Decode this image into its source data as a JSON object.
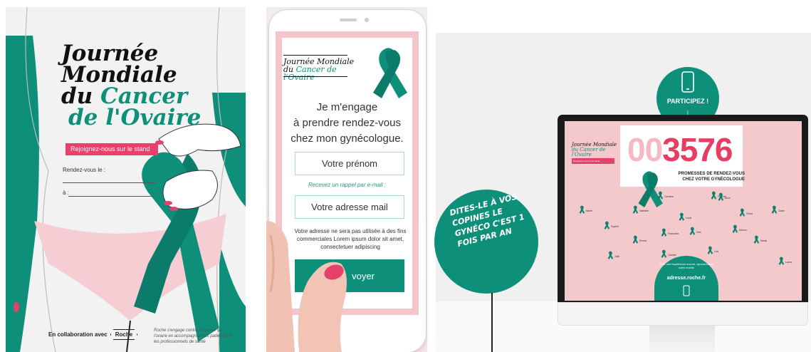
{
  "poster": {
    "title_line1": "Journée",
    "title_line2": "Mondiale",
    "title_du": "du ",
    "title_cancer": "Cancer",
    "title_ovaire": "de l'Ovaire",
    "banner": "Rejoignez-nous sur le stand",
    "field_date": "Rendez-vous le :",
    "field_place": "à :",
    "collab_label": "En collaboration avec",
    "brand": "Roche",
    "note": "Roche s'engage contre le cancer de l'ovaire en accompagnant les patientes et les professionnels de santé",
    "colors": {
      "accent": "#0d8f7a",
      "pink": "#e6416b"
    }
  },
  "phone": {
    "logo_line1": "Journée Mondiale",
    "logo_line2_du": "du ",
    "logo_line2_rest": "Cancer de l'Ovaire",
    "heading_1": "Je m'engage",
    "heading_2": "à prendre rendez-vous",
    "heading_3": "chez mon gynécologue.",
    "firstname_placeholder": "Votre prénom",
    "email_hint": "Recevez un rappel par e-mail :",
    "email_placeholder": "Votre adresse mail",
    "disclaimer": "Votre adresse ne sera pas utilisée à des fins commerciales Lorem ipsum dolor sit amet, consectetuer adipiscing",
    "send_label": "voyer"
  },
  "screen": {
    "logo_line1": "Journée Mondiale",
    "logo_line2": "du Cancer de l'Ovaire",
    "banner": "Rejoignez-nous sur le stand",
    "counter_dim": "00",
    "counter_hot": "3576",
    "promesses_1": "PROMESSES DE RENDEZ-VOUS",
    "promesses_2": "CHEZ VOTRE GYNÉCOLOGUE",
    "participez": "PARTICIPEZ !",
    "arrow": "↓",
    "bottom_text": "Pour une expérience encore, synchronisez votre mobile",
    "url": "adresse.roche.fr",
    "side_bubble": "Dites-le à vos copines le gynéco c'est 1 fois par an",
    "names": [
      "Marie",
      "Sophie",
      "Nathalie",
      "Caroline",
      "Lucie",
      "Pauline",
      "Chloé",
      "Claire",
      "Julie",
      "Emma",
      "Françoise",
      "Inès",
      "Léa",
      "Manon",
      "Sarah",
      "Laura",
      "Camille",
      "Alice"
    ]
  }
}
